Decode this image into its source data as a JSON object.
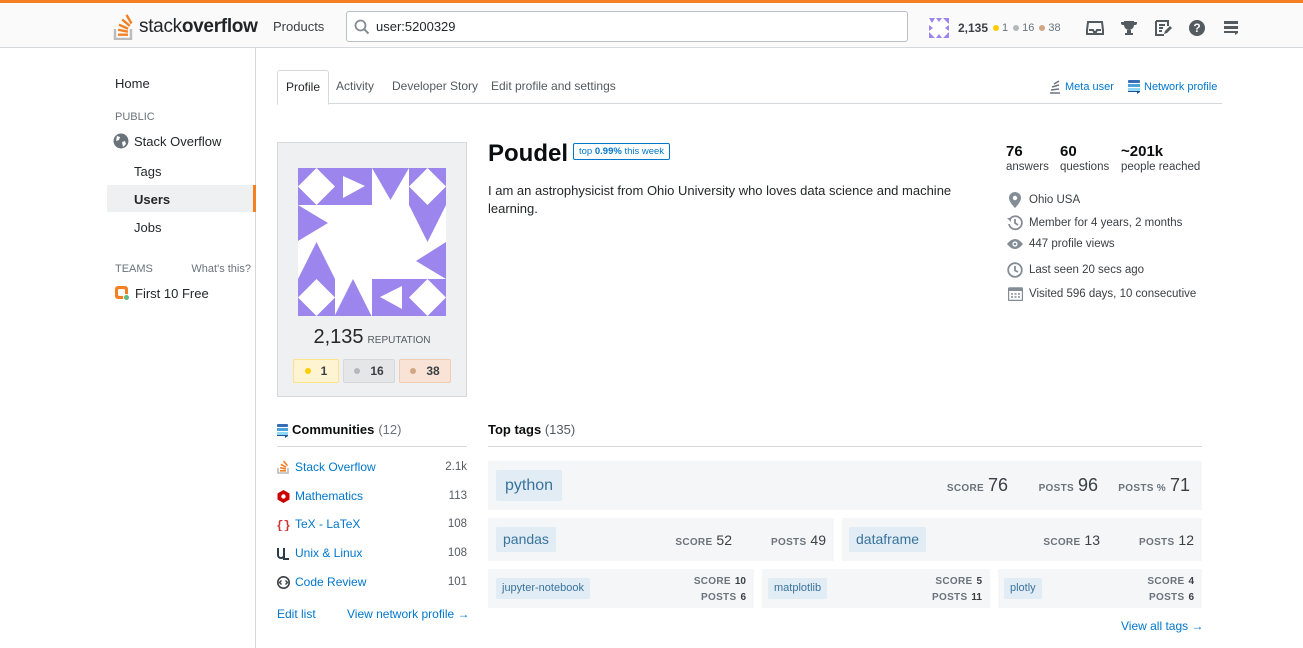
{
  "topbar": {
    "logo_regular": "stack",
    "logo_bold": "overflow",
    "products": "Products",
    "search_value": "user:5200329",
    "reputation": "2,135",
    "gold": "1",
    "silver": "16",
    "bronze": "38",
    "icons": [
      "inbox-icon",
      "achievements-icon",
      "review-icon",
      "help-icon",
      "site-switcher-icon"
    ]
  },
  "sidebar": {
    "home": "Home",
    "public": "PUBLIC",
    "stack_overflow": "Stack Overflow",
    "tags": "Tags",
    "users": "Users",
    "jobs": "Jobs",
    "teams": "TEAMS",
    "whats_this": "What's this?",
    "first_free": "First 10 Free"
  },
  "tabs": {
    "items": [
      "Profile",
      "Activity",
      "Developer Story",
      "Edit profile and settings"
    ],
    "meta_user": "Meta user",
    "network_profile": "Network profile"
  },
  "profile": {
    "reputation": "2,135",
    "reputation_label": "REPUTATION",
    "gold": "1",
    "silver": "16",
    "bronze": "38",
    "name": "Poudel",
    "top_badge_prefix": "top",
    "top_badge_value": "0.99%",
    "top_badge_suffix": "this week",
    "bio": "I am an astrophysicist from Ohio University who loves data science and machine learning.",
    "answers": "76",
    "answers_label": "answers",
    "questions": "60",
    "questions_label": "questions",
    "reached": "~201k",
    "reached_label": "people reached",
    "location": "Ohio USA",
    "member_for": "Member for 4 years, 2 months",
    "profile_views": "447 profile views",
    "last_seen": "Last seen 20 secs ago",
    "visited": "Visited 596 days, 10 consecutive"
  },
  "communities": {
    "title": "Communities",
    "count": "(12)",
    "items": [
      {
        "name": "Stack Overflow",
        "value": "2.1k"
      },
      {
        "name": "Mathematics",
        "value": "113"
      },
      {
        "name": "TeX - LaTeX",
        "value": "108"
      },
      {
        "name": "Unix & Linux",
        "value": "108"
      },
      {
        "name": "Code Review",
        "value": "101"
      }
    ],
    "edit_list": "Edit list",
    "view_network": "View network profile →"
  },
  "top_tags": {
    "title": "Top tags",
    "count": "(135)",
    "score_label": "SCORE",
    "posts_label": "POSTS",
    "posts_pct_label": "POSTS %",
    "tags": [
      {
        "name": "python",
        "score": "76",
        "posts": "96",
        "posts_pct": "71"
      },
      {
        "name": "pandas",
        "score": "52",
        "posts": "49"
      },
      {
        "name": "dataframe",
        "score": "13",
        "posts": "12"
      },
      {
        "name": "jupyter-notebook",
        "score": "10",
        "posts": "6"
      },
      {
        "name": "matplotlib",
        "score": "5",
        "posts": "11"
      },
      {
        "name": "plotly",
        "score": "4",
        "posts": "6"
      }
    ],
    "view_all": "View all tags →"
  },
  "colors": {
    "accent": "#f48024",
    "link": "#0077cc",
    "tag_bg": "#e1ecf4",
    "tag_text": "#39739d",
    "avatar": "#9c86ed"
  }
}
